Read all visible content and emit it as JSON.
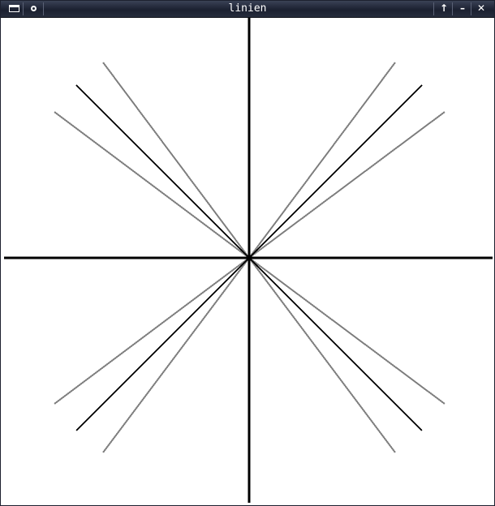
{
  "window": {
    "title": "linien",
    "buttons": {
      "menu_icon": "window-menu-icon",
      "sticky_icon": "sticky-icon",
      "maximize_glyph": "↑",
      "minimize_glyph": "–",
      "close_glyph": "✕"
    }
  },
  "colors": {
    "axis": "#000000",
    "diagonal": "#000000",
    "steep_shallow": "#808080",
    "background": "#ffffff"
  }
}
